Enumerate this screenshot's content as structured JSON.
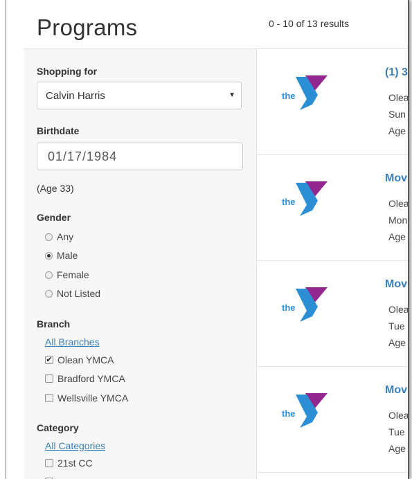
{
  "header": {
    "title": "Programs",
    "results_count": "0 - 10 of 13 results"
  },
  "filters": {
    "shopping_for": {
      "label": "Shopping for",
      "selected": "Calvin Harris"
    },
    "birthdate": {
      "label": "Birthdate",
      "value": "01/17/1984",
      "age_text": "(Age 33)"
    },
    "gender": {
      "label": "Gender",
      "options": [
        "Any",
        "Male",
        "Female",
        "Not Listed"
      ],
      "selected": "Male"
    },
    "branch": {
      "label": "Branch",
      "all_link": "All Branches",
      "options": [
        {
          "label": "Olean YMCA",
          "checked": true
        },
        {
          "label": "Bradford YMCA",
          "checked": false
        },
        {
          "label": "Wellsville YMCA",
          "checked": false
        }
      ]
    },
    "category": {
      "label": "Category",
      "all_link": "All Categories",
      "options": [
        {
          "label": "21st CC",
          "checked": false
        }
      ]
    }
  },
  "results": [
    {
      "title": "(1) 3",
      "line1": "Olea",
      "line2": "Sun",
      "line3": "Age"
    },
    {
      "title": "Mov",
      "line1": "Olea",
      "line2": "Mon",
      "line3": "Age"
    },
    {
      "title": "Mov",
      "line1": "Olea",
      "line2": "Tue",
      "line3": "Age"
    },
    {
      "title": "Mov",
      "line1": "Olea",
      "line2": "Tue",
      "line3": "Age"
    }
  ],
  "logo": {
    "text": "the",
    "colors": {
      "blue": "#2c8fd6",
      "purple": "#92278f"
    }
  }
}
